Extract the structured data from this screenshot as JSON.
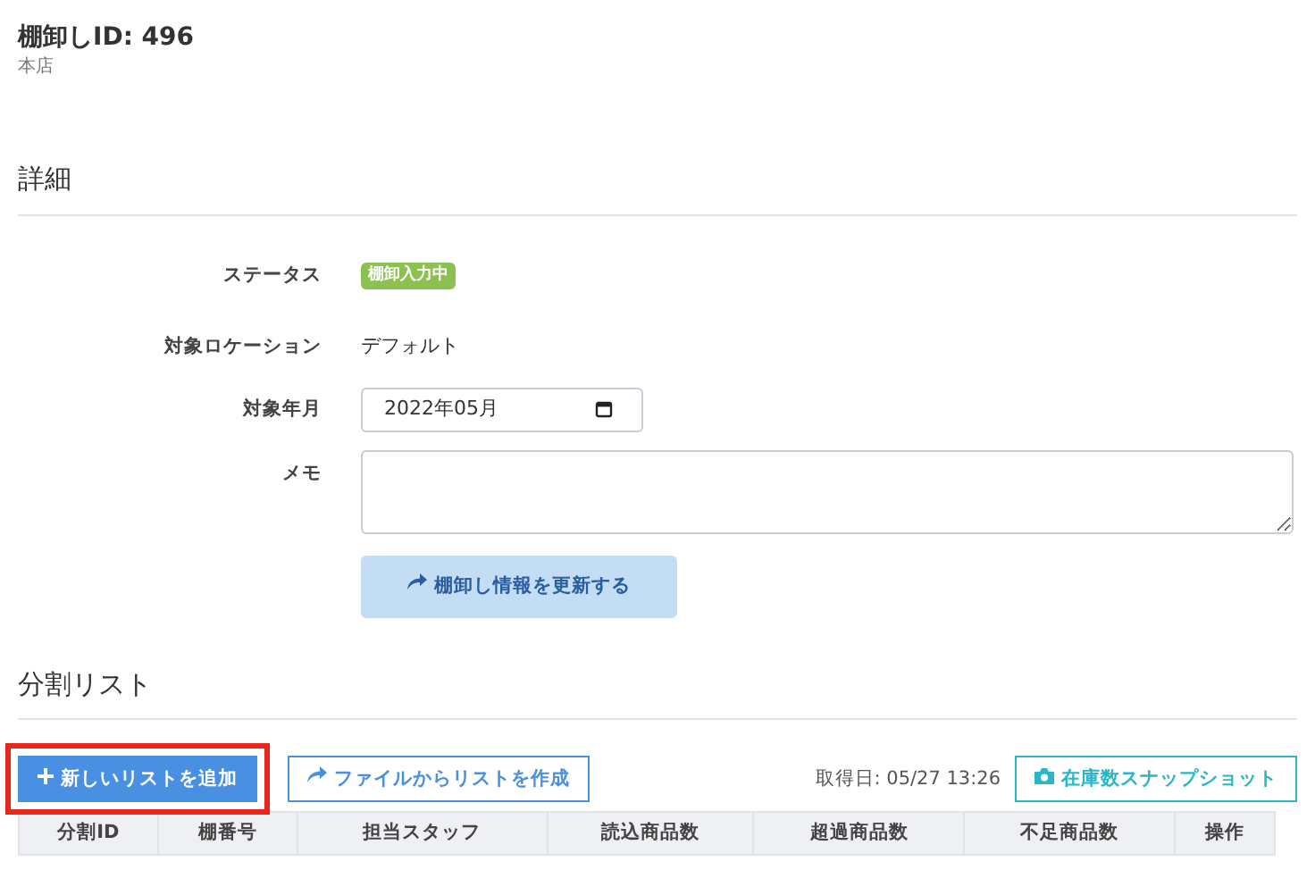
{
  "header": {
    "title": "棚卸しID: 496",
    "subtitle": "本店"
  },
  "details": {
    "heading": "詳細",
    "fields": [
      {
        "kind": "badge",
        "label": "ステータス",
        "value": "棚卸入力中",
        "color": "#8cc152"
      },
      {
        "kind": "text",
        "label": "対象ロケーション",
        "value": "デフォルト"
      },
      {
        "kind": "month",
        "label": "対象年月",
        "value": "2022年05月"
      },
      {
        "kind": "textarea",
        "label": "メモ"
      }
    ],
    "submit_button": {
      "label": "棚卸し情報を更新する",
      "disabled": true
    }
  },
  "split_list": {
    "heading": "分割リスト",
    "add_button": {
      "label": "新しいリストを追加",
      "highlighted": true
    },
    "file_button": {
      "label": "ファイルからリストを作成"
    },
    "fetched_at": "取得日: 05/27 13:26",
    "snapshot_button": {
      "label": "在庫数スナップショット"
    },
    "table": {
      "columns": [
        "分割ID",
        "棚番号",
        "担当スタッフ",
        "読込商品数",
        "超過商品数",
        "不足商品数",
        "操作"
      ]
    }
  }
}
